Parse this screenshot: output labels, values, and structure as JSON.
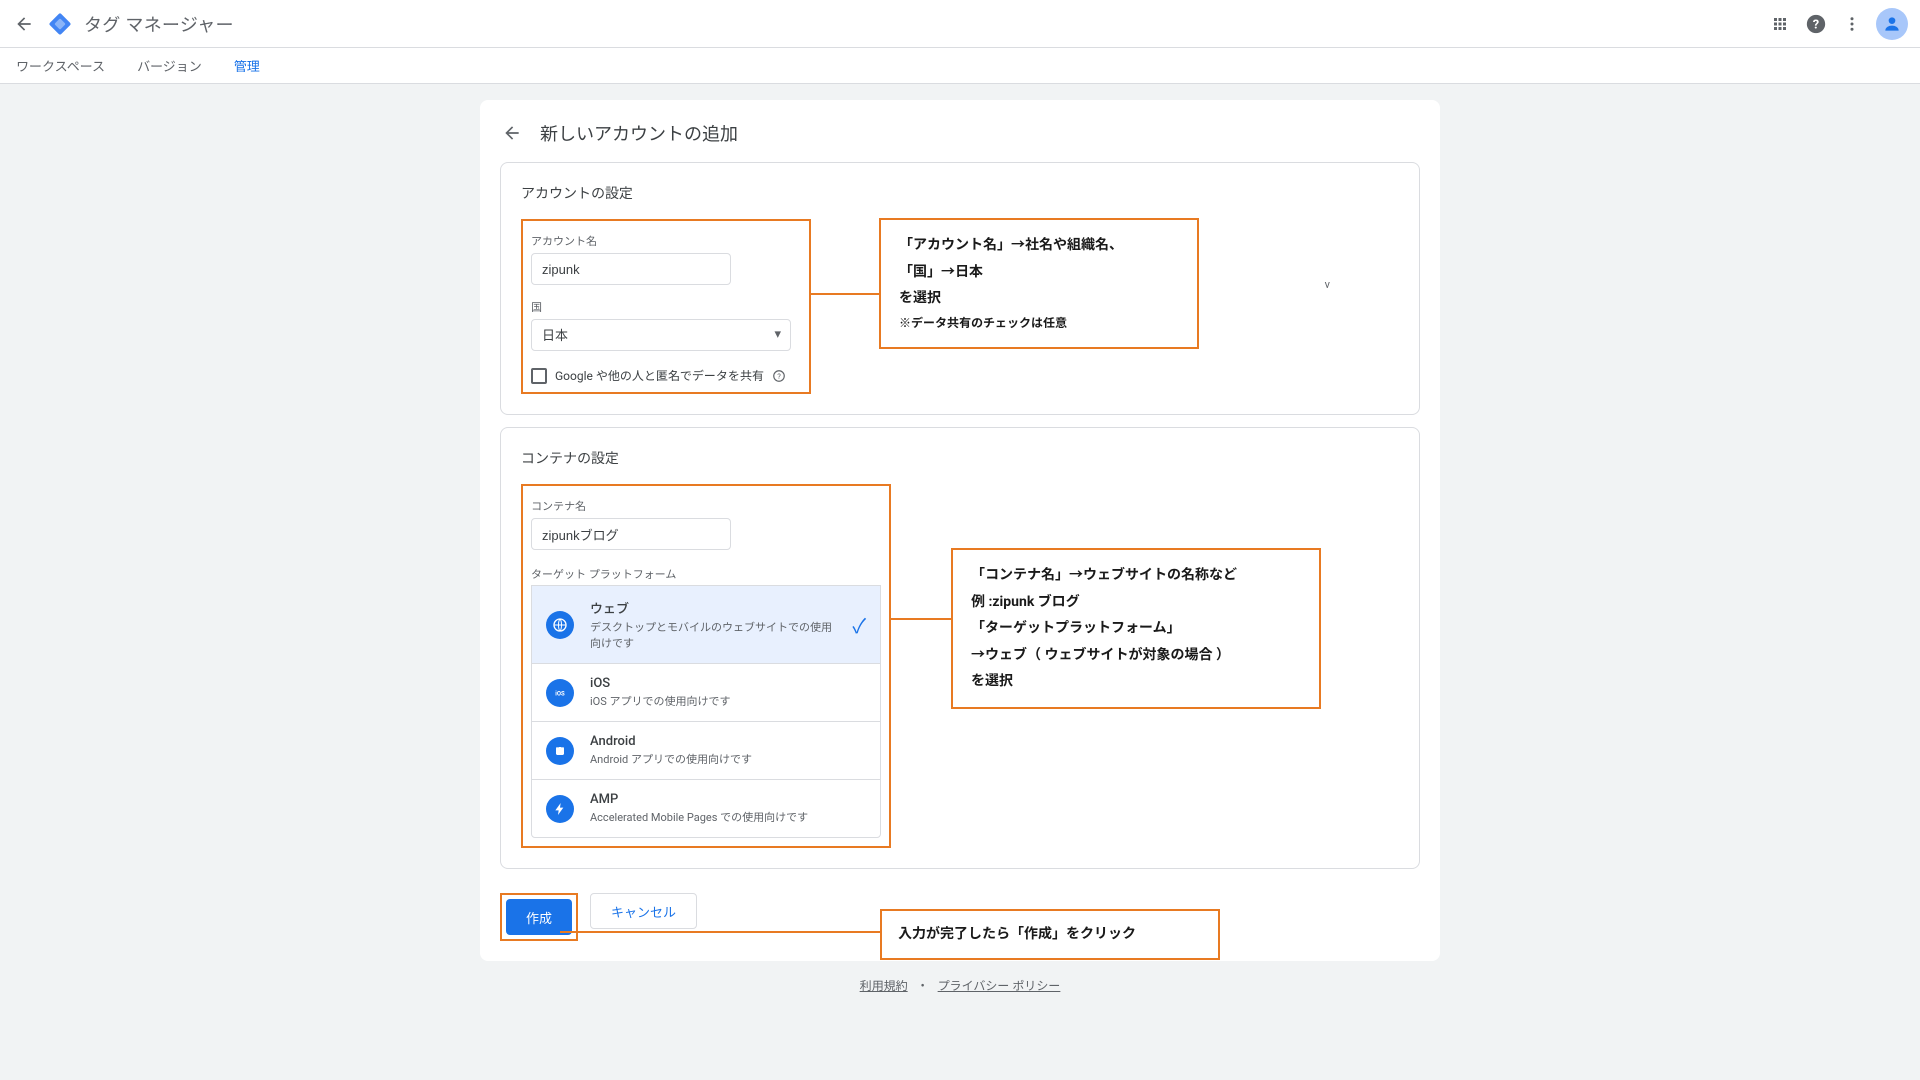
{
  "header": {
    "product_name": "タグ マネージャー"
  },
  "nav": {
    "workspace": "ワークスペース",
    "version": "バージョン",
    "admin": "管理"
  },
  "page": {
    "title": "新しいアカウントの追加"
  },
  "account_section": {
    "title": "アカウントの設定",
    "name_label": "アカウント名",
    "name_value": "zipunk",
    "country_label": "国",
    "country_value": "日本",
    "share_label": "Google や他の人と匿名でデータを共有"
  },
  "container_section": {
    "title": "コンテナの設定",
    "name_label": "コンテナ名",
    "name_value": "zipunkブログ",
    "platform_label": "ターゲット プラットフォーム",
    "platforms": [
      {
        "name": "ウェブ",
        "desc": "デスクトップとモバイルのウェブサイトでの使用向けです",
        "selected": true
      },
      {
        "name": "iOS",
        "desc": "iOS アプリでの使用向けです",
        "selected": false
      },
      {
        "name": "Android",
        "desc": "Android アプリでの使用向けです",
        "selected": false
      },
      {
        "name": "AMP",
        "desc": "Accelerated Mobile Pages での使用向けです",
        "selected": false
      }
    ]
  },
  "buttons": {
    "create": "作成",
    "cancel": "キャンセル"
  },
  "annotations": {
    "account_line1": "「アカウント名」→社名や組織名、",
    "account_line2": "「国」→日本",
    "account_line3": "を選択",
    "account_note": "※データ共有のチェックは任意",
    "container_line1": "「コンテナ名」→ウェブサイトの名称など",
    "container_line2": "例 :zipunk ブログ",
    "container_line3": "「ターゲットプラットフォーム」",
    "container_line4": "→ウェブ（ ウェブサイトが対象の場合 ）",
    "container_line5": "を選択",
    "create_note": "入力が完了したら「作成」をクリック"
  },
  "footer": {
    "terms": "利用規約",
    "privacy": "プライバシー ポリシー"
  },
  "stray": "v"
}
